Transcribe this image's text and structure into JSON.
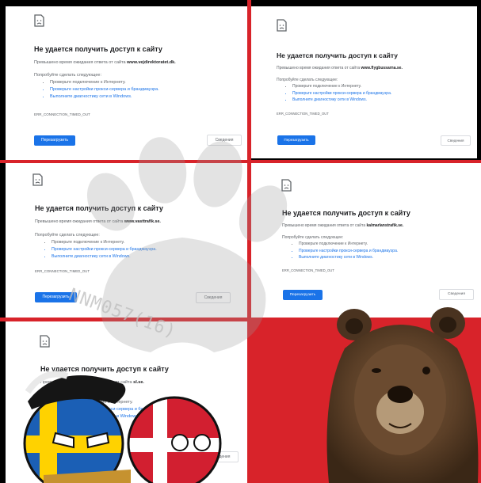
{
  "common": {
    "title": "Не удается получить доступ к сайту",
    "msg_prefix": "Превышено время ожидания ответа от сайта",
    "try_label": "Попробуйте сделать следующее:",
    "bullet_1": "Проверьте подключение к Интернету.",
    "bullet_2": "Проверьте настройки прокси-сервера и брандмауэра.",
    "bullet_3": "Выполните диагностику сети в Windows.",
    "error_code": "ERR_CONNECTION_TIMED_OUT",
    "reload_label": "Перезагрузить",
    "details_label": "Сведения"
  },
  "tiles": [
    {
      "site": "www.vejdirektoratet.dk."
    },
    {
      "site": "www.flygbussarna.se."
    },
    {
      "site": "www.vasttrafik.se."
    },
    {
      "site": "kalmarlanstrafik.se."
    },
    {
      "site": "sl.se."
    }
  ],
  "watermark": {
    "text": "NNM057(16)"
  },
  "colors": {
    "accent_blue": "#1a73e8",
    "red": "#d8232a"
  }
}
